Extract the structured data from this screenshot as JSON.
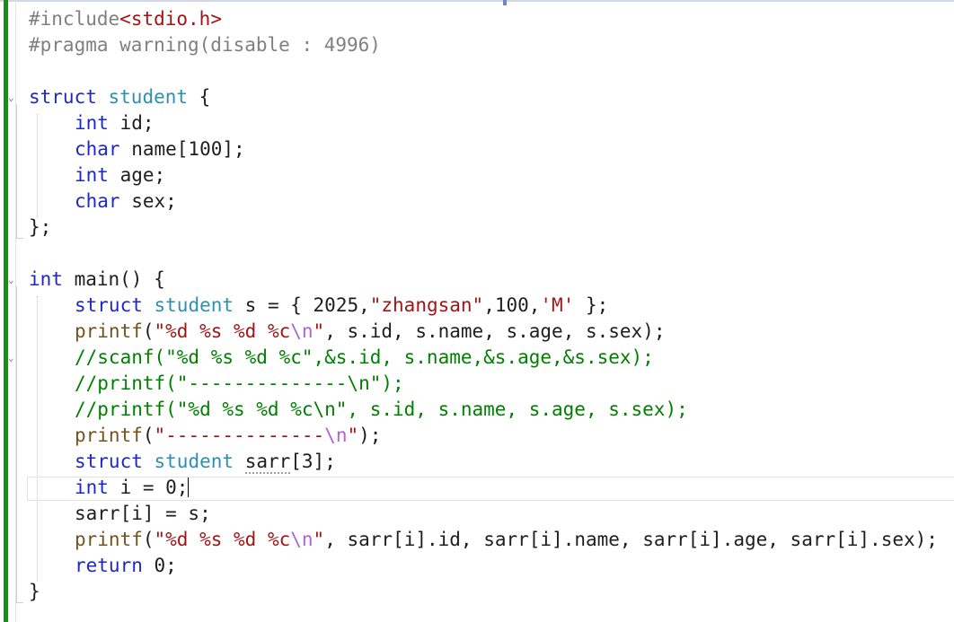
{
  "editor": {
    "language": "C",
    "caret_line": 19,
    "changed_lines_marker": "green",
    "code": {
      "line1": {
        "directive": "#include",
        "header_open": "<",
        "header_name": "stdio.h",
        "header_close": ">"
      },
      "line2": {
        "directive": "#pragma warning",
        "args": "(disable : 4996)"
      },
      "line4": {
        "kw": "struct",
        "type": "student",
        "tail": " {"
      },
      "line5": {
        "kw": "int",
        "tail": " id;"
      },
      "line6": {
        "kw": "char",
        "tail": " name[100];"
      },
      "line7": {
        "kw": "int",
        "tail": " age;"
      },
      "line8": {
        "kw": "char",
        "tail": " sex;"
      },
      "line9": {
        "text": "};"
      },
      "line11": {
        "kw": "int",
        "tail": " main() {"
      },
      "line12": {
        "kw": "struct",
        "type": "student",
        "var": " s = { 2025,",
        "str": "\"zhangsan\"",
        "mid": ",100,",
        "chr": "'M'",
        "tail": " };"
      },
      "line13": {
        "fn": "printf",
        "open": "(",
        "str": "\"%d %s %d %c",
        "esc": "\\n",
        "str_end": "\"",
        "tail": ", s.id, s.name, s.age, s.sex);"
      },
      "line14": {
        "comment": "//scanf(\"%d %s %d %c\",&s.id, s.name,&s.age,&s.sex);"
      },
      "line15": {
        "comment": "//printf(\"--------------\\n\");"
      },
      "line16": {
        "comment": "//printf(\"%d %s %d %c\\n\", s.id, s.name, s.age, s.sex);"
      },
      "line17": {
        "fn": "printf",
        "open": "(",
        "str": "\"--------------",
        "esc": "\\n",
        "str_end": "\"",
        "tail": ");"
      },
      "line18": {
        "kw": "struct",
        "type": "student",
        "var": "sarr",
        "tail": "[3];"
      },
      "line19": {
        "kw": "int",
        "tail": " i = 0;"
      },
      "line20": {
        "text": "sarr[i] = s;"
      },
      "line21": {
        "fn": "printf",
        "open": "(",
        "str": "\"%d %s %d %c",
        "esc": "\\n",
        "str_end": "\"",
        "tail": ", sarr[i].id, sarr[i].name, sarr[i].age, sarr[i].sex);"
      },
      "line22": {
        "kw": "return",
        "tail": " 0;"
      },
      "line23": {
        "text": "}"
      }
    }
  }
}
